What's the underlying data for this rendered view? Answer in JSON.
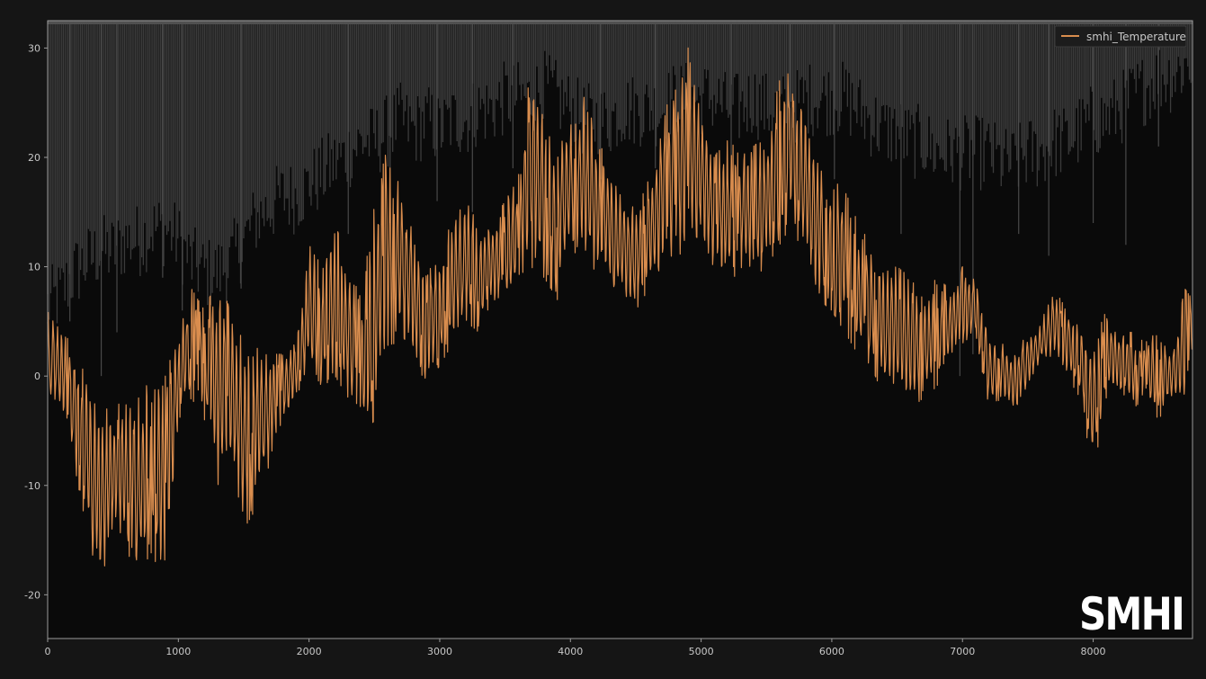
{
  "chart_data": {
    "type": "line",
    "title": "",
    "xlabel": "",
    "ylabel": "",
    "xlim": [
      0,
      8760
    ],
    "ylim": [
      -24,
      32.5
    ],
    "x_ticks": [
      0,
      1000,
      2000,
      3000,
      4000,
      5000,
      6000,
      7000,
      8000
    ],
    "y_ticks": [
      -20,
      -10,
      0,
      10,
      20,
      30
    ],
    "grid": false,
    "legend_position": "top-right",
    "series": [
      {
        "name": "smhi_Temperature",
        "color": "#d98d4e",
        "x": [
          0,
          100,
          200,
          300,
          400,
          500,
          600,
          700,
          800,
          900,
          1000,
          1100,
          1200,
          1300,
          1400,
          1500,
          1600,
          1700,
          1800,
          1900,
          2000,
          2100,
          2200,
          2300,
          2400,
          2500,
          2600,
          2700,
          2800,
          2900,
          3000,
          3100,
          3200,
          3300,
          3400,
          3500,
          3600,
          3700,
          3800,
          3900,
          4000,
          4100,
          4200,
          4300,
          4400,
          4500,
          4600,
          4700,
          4800,
          4900,
          5000,
          5100,
          5200,
          5300,
          5400,
          5500,
          5600,
          5700,
          5800,
          5900,
          6000,
          6100,
          6200,
          6300,
          6400,
          6500,
          6600,
          6700,
          6800,
          6900,
          7000,
          7100,
          7200,
          7300,
          7400,
          7500,
          7600,
          7700,
          7800,
          7900,
          8000,
          8100,
          8200,
          8300,
          8400,
          8500,
          8600,
          8700,
          8760
        ],
        "upper": [
          6,
          5,
          2,
          0,
          -3,
          -3,
          -2,
          -2,
          0,
          0,
          4,
          8,
          6,
          9,
          6,
          3,
          3,
          2,
          2,
          3,
          12,
          10,
          14,
          10,
          7,
          16,
          21,
          17,
          13,
          9,
          12,
          14,
          17,
          13,
          14,
          16,
          18,
          29,
          24,
          21,
          23,
          26,
          22,
          19,
          17,
          15,
          18,
          24,
          26,
          30,
          24,
          20,
          22,
          20,
          21,
          22,
          27,
          28,
          24,
          20,
          18,
          17,
          14,
          12,
          11,
          10,
          9,
          7,
          9,
          8,
          10,
          9,
          4,
          3,
          2,
          4,
          5,
          8,
          6,
          5,
          3,
          6,
          4,
          4,
          3,
          5,
          2,
          8,
          7
        ],
        "lower": [
          -2,
          -4,
          -8,
          -14,
          -20,
          -14,
          -16,
          -18,
          -16,
          -20,
          -4,
          -2,
          -4,
          -10,
          -8,
          -14,
          -12,
          -8,
          -4,
          -2,
          1,
          -1,
          0,
          -2,
          -6,
          -4,
          2,
          4,
          2,
          -1,
          1,
          3,
          5,
          4,
          7,
          6,
          8,
          10,
          9,
          7,
          12,
          10,
          9,
          8,
          7,
          6,
          8,
          9,
          10,
          12,
          13,
          9,
          8,
          10,
          9,
          10,
          12,
          14,
          10,
          7,
          6,
          4,
          2,
          1,
          -2,
          -1,
          -3,
          -2,
          -1,
          1,
          3,
          4,
          -3,
          -2,
          -3,
          -1,
          1,
          2,
          0,
          -2,
          -9,
          -2,
          -1,
          -3,
          -2,
          -4,
          -2,
          -3,
          2
        ]
      },
      {
        "name": "",
        "color": "#505050",
        "x": [
          0,
          100,
          200,
          300,
          400,
          500,
          600,
          700,
          800,
          900,
          1000,
          1100,
          1200,
          1300,
          1400,
          1500,
          1600,
          1700,
          1800,
          1900,
          2000,
          2100,
          2200,
          2300,
          2400,
          2500,
          2600,
          2700,
          2800,
          2900,
          3000,
          3100,
          3200,
          3300,
          3400,
          3500,
          3600,
          3700,
          3800,
          3900,
          4000,
          4100,
          4200,
          4300,
          4400,
          4500,
          4600,
          4700,
          4800,
          4900,
          5000,
          5100,
          5200,
          5300,
          5400,
          5500,
          5600,
          5700,
          5800,
          5900,
          6000,
          6100,
          6200,
          6300,
          6400,
          6500,
          6600,
          6700,
          6800,
          6900,
          7000,
          7100,
          7200,
          7300,
          7400,
          7500,
          7600,
          7700,
          7800,
          7900,
          8000,
          8100,
          8200,
          8300,
          8400,
          8500,
          8600,
          8700,
          8760
        ],
        "lower": [
          5,
          6,
          8,
          9,
          10,
          10,
          11,
          11,
          12,
          12,
          11,
          9,
          8,
          8,
          9,
          11,
          13,
          14,
          15,
          15,
          16,
          17,
          18,
          19,
          20,
          20,
          21,
          22,
          21,
          22,
          21,
          22,
          22,
          23,
          23,
          24,
          24,
          24,
          25,
          24,
          23,
          22,
          22,
          22,
          23,
          23,
          23,
          23,
          24,
          24,
          24,
          24,
          23,
          23,
          24,
          23,
          23,
          23,
          24,
          24,
          24,
          24,
          23,
          22,
          21,
          21,
          20,
          20,
          19,
          19,
          19,
          19,
          19,
          18,
          18,
          19,
          19,
          20,
          20,
          21,
          22,
          22,
          23,
          24,
          25,
          26,
          26,
          27,
          27
        ],
        "dips": [
          [
            170,
            5
          ],
          [
            410,
            0
          ],
          [
            530,
            4
          ],
          [
            880,
            9
          ],
          [
            1030,
            6
          ],
          [
            1480,
            8
          ],
          [
            2300,
            13
          ],
          [
            2620,
            14
          ],
          [
            2980,
            16
          ],
          [
            3250,
            15
          ],
          [
            3560,
            19
          ],
          [
            4230,
            18
          ],
          [
            4650,
            19
          ],
          [
            5230,
            17
          ],
          [
            5680,
            19
          ],
          [
            6020,
            18
          ],
          [
            6530,
            13
          ],
          [
            6980,
            0
          ],
          [
            7080,
            2
          ],
          [
            7430,
            13
          ],
          [
            7660,
            11
          ],
          [
            8000,
            14
          ],
          [
            8250,
            12
          ],
          [
            8500,
            21
          ]
        ]
      }
    ]
  }
}
